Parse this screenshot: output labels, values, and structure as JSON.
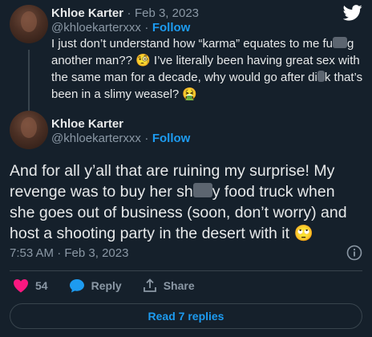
{
  "reply_tweet": {
    "name": "Khloe Karter",
    "separator": "·",
    "date": "Feb 3, 2023",
    "handle": "@khloekarterxxx",
    "dot": "·",
    "follow": "Follow",
    "text_1": "I just don’t understand how “karma” equates to me fu",
    "text_2": "g another man?? ",
    "emoji_1": "🧐",
    "text_3": " I’ve literally been having great sex with the same man for a decade, why would go after di",
    "text_4": "k that’s been in a slimy weasel? ",
    "emoji_2": "🤮"
  },
  "main_tweet": {
    "name": "Khloe Karter",
    "handle": "@khloekarterxxx",
    "dot": "·",
    "follow": "Follow",
    "text_1": "And for all y’all that are ruining my surprise! My revenge was to buy her sh",
    "text_2": "y food truck when she goes out of business (soon, don’t worry) and host a shooting party in the desert with it ",
    "emoji": "🙄",
    "time": "7:53 AM",
    "time_sep": " · ",
    "date": "Feb 3, 2023"
  },
  "actions": {
    "likes": "54",
    "reply": "Reply",
    "share": "Share"
  },
  "read_replies": "Read 7 replies",
  "colors": {
    "background": "#15202b",
    "accent": "#1d9bf0",
    "like": "#f91880"
  }
}
